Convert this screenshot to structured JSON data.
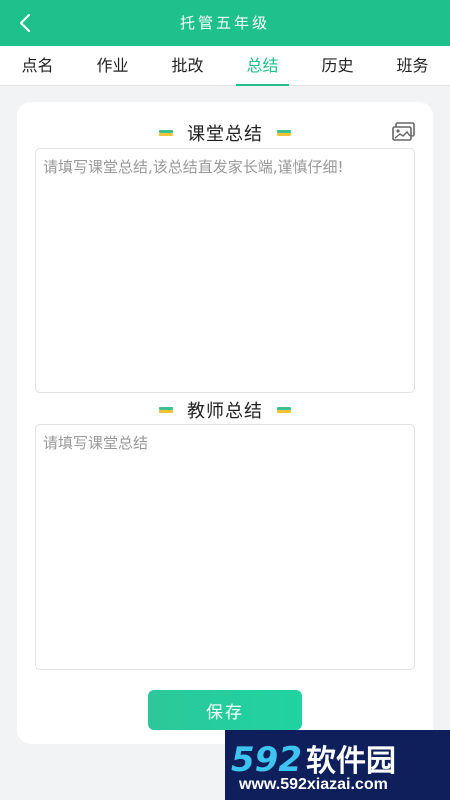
{
  "header": {
    "title": "托管五年级",
    "back_icon": "chevron-left-icon"
  },
  "tabs": [
    {
      "label": "点名",
      "active": false
    },
    {
      "label": "作业",
      "active": false
    },
    {
      "label": "批改",
      "active": false
    },
    {
      "label": "总结",
      "active": true
    },
    {
      "label": "历史",
      "active": false
    },
    {
      "label": "班务",
      "active": false
    }
  ],
  "class_summary": {
    "title": "课堂总结",
    "placeholder": "请填写课堂总结,该总结直发家长端,谨慎仔细!",
    "value": "",
    "image_icon": "image-gallery-icon"
  },
  "teacher_summary": {
    "title": "教师总结",
    "placeholder": "请填写课堂总结",
    "value": ""
  },
  "save_label": "保存",
  "watermark": {
    "brand_number": "592",
    "brand_text": "软件园",
    "url": "www.592xiazai.com"
  },
  "colors": {
    "accent": "#1ec08b",
    "background": "#f2f3f5",
    "watermark_bg": "#0f1f5c"
  }
}
